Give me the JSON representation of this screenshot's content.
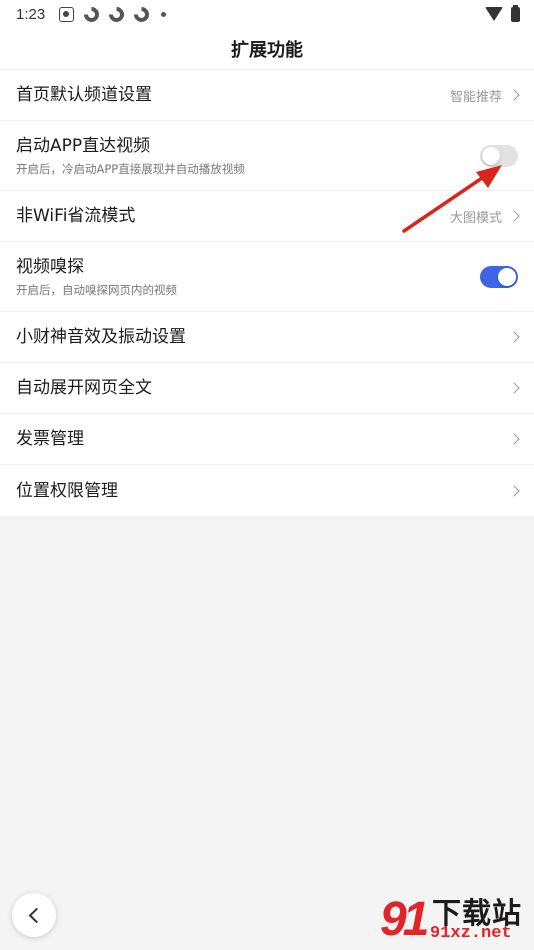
{
  "status_bar": {
    "time": "1:23"
  },
  "page_title": "扩展功能",
  "settings": [
    {
      "label": "首页默认频道设置",
      "value": "智能推荐",
      "type": "link"
    },
    {
      "label": "启动APP直达视频",
      "subtitle": "开启后，冷启动APP直接展现并自动播放视频",
      "type": "toggle",
      "on": false
    },
    {
      "label": "非WiFi省流模式",
      "value": "大图模式",
      "type": "link"
    },
    {
      "label": "视频嗅探",
      "subtitle": "开启后，自动嗅探网页内的视频",
      "type": "toggle",
      "on": true
    },
    {
      "label": "小财神音效及振动设置",
      "type": "link"
    },
    {
      "label": "自动展开网页全文",
      "type": "link"
    },
    {
      "label": "发票管理",
      "type": "link"
    },
    {
      "label": "位置权限管理",
      "type": "link"
    }
  ],
  "watermark": {
    "mark": "91",
    "title": "下载站",
    "url": "91xz.net"
  },
  "colors": {
    "accent": "#3e65e8",
    "annotation_arrow": "#d9261c",
    "watermark_red": "#e1232a"
  },
  "icons": [
    "baidu-app-icon",
    "sync-ring-icon",
    "wifi-icon",
    "battery-icon",
    "chevron-right-icon",
    "back-chevron-icon"
  ]
}
